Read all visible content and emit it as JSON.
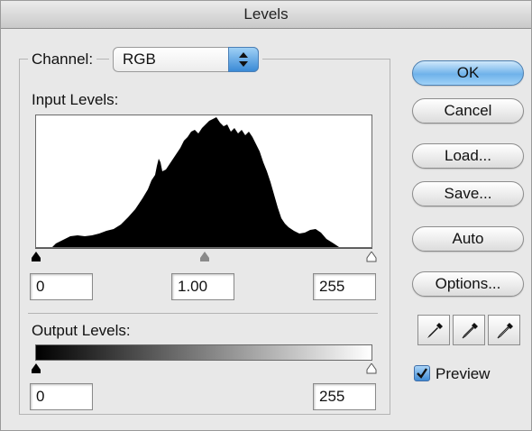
{
  "window": {
    "title": "Levels"
  },
  "channel": {
    "label": "Channel:",
    "value": "RGB"
  },
  "input_levels": {
    "label": "Input Levels:",
    "black": "0",
    "gamma": "1.00",
    "white": "255"
  },
  "output_levels": {
    "label": "Output Levels:",
    "black": "0",
    "white": "255"
  },
  "buttons": {
    "ok": "OK",
    "cancel": "Cancel",
    "load": "Load...",
    "save": "Save...",
    "auto": "Auto",
    "options": "Options..."
  },
  "preview": {
    "label": "Preview",
    "checked": true
  },
  "icons": {
    "channel_arrows": "up-down-arrows-icon",
    "black_eyedropper": "eyedropper-black-icon",
    "gray_eyedropper": "eyedropper-gray-icon",
    "white_eyedropper": "eyedropper-white-icon"
  },
  "colors": {
    "accent": "#3a8ad6",
    "histogram": "#000000"
  }
}
